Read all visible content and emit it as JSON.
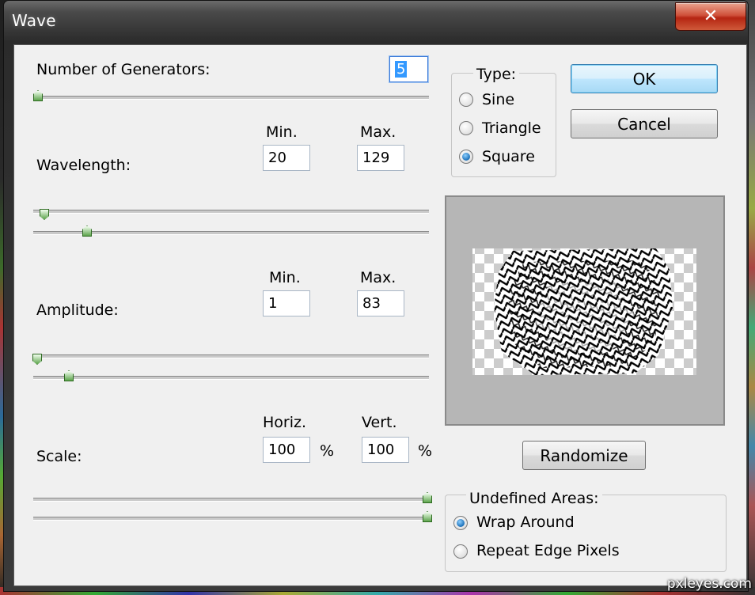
{
  "window": {
    "title": "Wave",
    "close_glyph": "✕"
  },
  "generators": {
    "label": "Number of Generators:",
    "value": "5",
    "slider_level": 0.01
  },
  "wavelength": {
    "label": "Wavelength:",
    "min_header": "Min.",
    "max_header": "Max.",
    "min": "20",
    "max": "129"
  },
  "amplitude": {
    "label": "Amplitude:",
    "min_header": "Min.",
    "max_header": "Max.",
    "min": "1",
    "max": "83"
  },
  "scale": {
    "label": "Scale:",
    "horiz_header": "Horiz.",
    "vert_header": "Vert.",
    "horiz": "100",
    "vert": "100",
    "unit": "%"
  },
  "type": {
    "title": "Type:",
    "options": [
      "Sine",
      "Triangle",
      "Square"
    ],
    "selected": "Square"
  },
  "buttons": {
    "ok": "OK",
    "cancel": "Cancel",
    "randomize": "Randomize"
  },
  "undefined_areas": {
    "title": "Undefined Areas:",
    "options": [
      "Wrap Around",
      "Repeat Edge Pixels"
    ],
    "selected": "Wrap Around"
  },
  "watermark": "pxleyes.com",
  "colors": {
    "ok_button": "#bee6fd",
    "slider_thumb": "#5da44c",
    "selection": "#3399ff"
  }
}
